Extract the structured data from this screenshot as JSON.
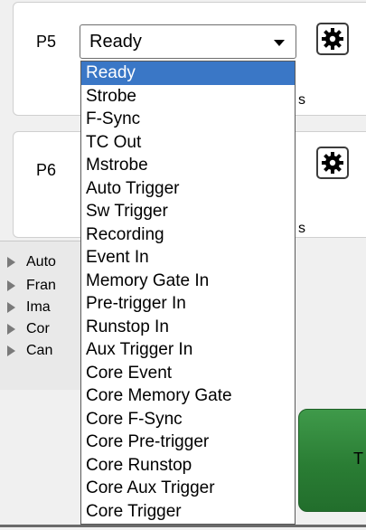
{
  "ports": [
    {
      "label": "P5",
      "value": "Ready",
      "stub": "s"
    },
    {
      "label": "P6",
      "stub": "s"
    }
  ],
  "tree_items": [
    "Auto",
    "Fran",
    "Ima",
    "Cor",
    "Can"
  ],
  "green_button_label": "T",
  "dropdown": {
    "selected": "Ready",
    "options": [
      "Ready",
      "Strobe",
      "F-Sync",
      "TC Out",
      "Mstrobe",
      "Auto Trigger",
      "Sw Trigger",
      "Recording",
      "Event In",
      "Memory Gate In",
      "Pre-trigger In",
      "Runstop In",
      "Aux Trigger In",
      "Core Event",
      "Core Memory Gate",
      "Core F-Sync",
      "Core Pre-trigger",
      "Core Runstop",
      "Core Aux Trigger",
      "Core Trigger"
    ]
  },
  "icons": {
    "settings": "gear-icon",
    "tree_expand": "triangle-right-icon",
    "combo": "chevron-down-icon"
  },
  "colors": {
    "selection": "#3a77c6",
    "action_button": "#2a7d34"
  }
}
